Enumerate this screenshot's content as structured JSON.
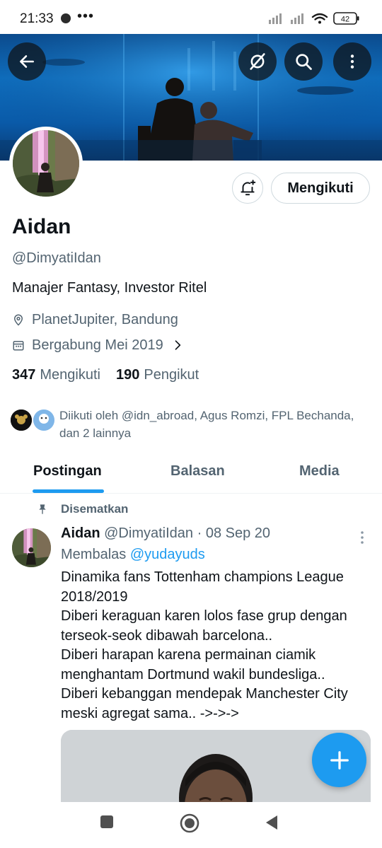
{
  "status_bar": {
    "time": "21:33",
    "more": "•••",
    "battery": "42"
  },
  "header": {
    "back_icon": "arrow-left-icon",
    "grok_icon": "grok-icon",
    "search_icon": "search-icon",
    "more_icon": "more-vertical-icon"
  },
  "profile": {
    "notify_icon": "bell-plus-icon",
    "follow_label": "Mengikuti",
    "display_name": "Aidan",
    "handle": "@DimyatiIdan",
    "bio": "Manajer Fantasy, Investor Ritel",
    "location": "PlanetJupiter, Bandung",
    "joined": "Bergabung Mei 2019",
    "following_count": "347",
    "following_label": "Mengikuti",
    "followers_count": "190",
    "followers_label": "Pengikut",
    "followed_by_line1": "Diikuti oleh @idn_abroad, Agus Romzi, FPL Bechanda,",
    "followed_by_line2": "dan 2 lainnya"
  },
  "tabs": [
    {
      "label": "Postingan",
      "active": true
    },
    {
      "label": "Balasan",
      "active": false
    },
    {
      "label": "Media",
      "active": false
    }
  ],
  "tweet": {
    "pinned_label": "Disematkan",
    "author_name": "Aidan",
    "author_handle": "@DimyatiIdan",
    "separator": "·",
    "date": "08 Sep 20",
    "reply_prefix": "Membalas",
    "reply_mention": "@yudayuds",
    "lines": [
      "Dinamika fans Tottenham champions League",
      "2018/2019",
      "Diberi keraguan karen lolos fase grup dengan",
      "terseok-seok dibawah barcelona..",
      "Diberi harapan karena permainan ciamik",
      "menghantam Dortmund wakil bundesliga..",
      "Diberi kebanggan mendepak Manchester City",
      "meski agregat sama.. ->->->"
    ]
  },
  "fab": {
    "icon": "plus-icon"
  },
  "colors": {
    "accent": "#1d9bf0",
    "text_primary": "#0f1419",
    "text_secondary": "#536471",
    "border": "#cfd9de"
  }
}
